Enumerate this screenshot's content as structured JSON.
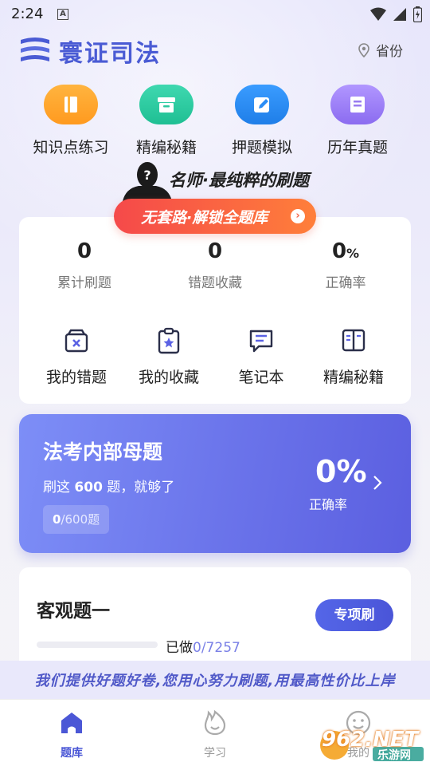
{
  "status_bar": {
    "time": "2:24",
    "notif": "A"
  },
  "header": {
    "app_name": "寰证司法",
    "province_label": "省份"
  },
  "quick_actions": [
    {
      "label": "知识点练习",
      "icon": "book-icon",
      "color": "#ffa52b"
    },
    {
      "label": "精编秘籍",
      "icon": "archive-box-icon",
      "color": "#2fc8a0"
    },
    {
      "label": "押题模拟",
      "icon": "pencil-icon",
      "color": "#2a8cf5"
    },
    {
      "label": "历年真题",
      "icon": "scroll-icon",
      "color": "#9a7cf0"
    }
  ],
  "banner": {
    "title": "名师·最纯粹的刷题",
    "button_label": "无套路·解锁全题库",
    "head_glyph": "?"
  },
  "stats": [
    {
      "value": "0",
      "suffix": "",
      "label": "累计刷题"
    },
    {
      "value": "0",
      "suffix": "",
      "label": "错题收藏"
    },
    {
      "value": "0",
      "suffix": "%",
      "label": "正确率"
    }
  ],
  "tools": [
    {
      "label": "我的错题",
      "icon": "wrong-box-icon"
    },
    {
      "label": "我的收藏",
      "icon": "star-clipboard-icon"
    },
    {
      "label": "笔记本",
      "icon": "notebook-icon"
    },
    {
      "label": "精编秘籍",
      "icon": "open-book-icon"
    }
  ],
  "promo": {
    "title": "法考内部母题",
    "subtitle_pre": "刷这 ",
    "subtitle_num": "600",
    "subtitle_post": " 题，就够了",
    "done": "0",
    "total": "/600题",
    "rate": "0%",
    "rate_label": "正确率",
    "progress_fraction": 0
  },
  "objective": {
    "title": "客观题一",
    "button_label": "专项刷",
    "done_label": "已做",
    "done": "0",
    "total": "/7257",
    "progress_fraction": 0
  },
  "slogan": "我们提供好题好卷,您用心努力刷题,用最高性价比上岸",
  "nav": [
    {
      "label": "题库",
      "icon": "home-icon",
      "active": true
    },
    {
      "label": "学习",
      "icon": "flame-icon",
      "active": false
    },
    {
      "label": "我的",
      "icon": "smile-icon",
      "active": false
    }
  ],
  "watermark": {
    "text": "962.NET",
    "sub": "乐游网"
  },
  "colors": {
    "accent": "#4a55d8",
    "promo_gradient_start": "#7d8ef7",
    "promo_gradient_end": "#5b5fe0",
    "cta": "#f5494a"
  }
}
